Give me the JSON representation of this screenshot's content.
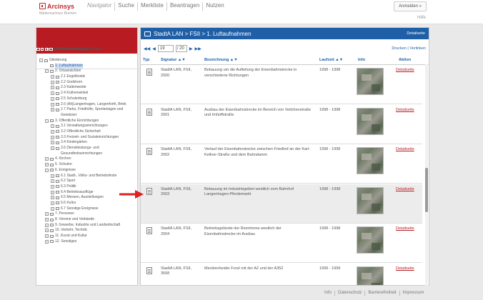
{
  "header": {
    "app_name": "Arcinsys",
    "app_sub": "Niedersachsen\nBremen",
    "nav": [
      "Navigator",
      "Suche",
      "Merkliste",
      "Beantragen",
      "Nutzen"
    ],
    "login": "Anmelden »",
    "help": "Hilfe"
  },
  "left": {
    "path": [
      "Archive in Niedersachsen und Bremen",
      "Stadtarchiv Langenhagen",
      "FSII Fotosammlung II"
    ],
    "tree": [
      {
        "label": "Gliederung",
        "level": 0,
        "kind": "folder",
        "toggle": "−"
      },
      {
        "label": "1. Luftaufnahmen",
        "level": 1,
        "kind": "file",
        "toggle": "",
        "selected": true
      },
      {
        "label": "2. Ortsansichten",
        "level": 1,
        "kind": "folder",
        "toggle": "−"
      },
      {
        "label": "2.1 Engelbostel",
        "level": 2,
        "kind": "file",
        "toggle": "+"
      },
      {
        "label": "2.2 Godshorn",
        "level": 2,
        "kind": "file",
        "toggle": "+"
      },
      {
        "label": "2.3 Kaltenweide",
        "level": 2,
        "kind": "file",
        "toggle": "+"
      },
      {
        "label": "2.4 Krähenwinkel",
        "level": 2,
        "kind": "file",
        "toggle": "+"
      },
      {
        "label": "2.5 Schulenburg",
        "level": 2,
        "kind": "file",
        "toggle": "+"
      },
      {
        "label": "2.6 (Alt)Langenhagen, Langenforth, Brink",
        "level": 2,
        "kind": "file",
        "toggle": "+"
      },
      {
        "label": "2.7 Parks, Friedhöfe, Sportanlagen und Gewässer",
        "level": 2,
        "kind": "file",
        "toggle": "+",
        "wrap": true
      },
      {
        "label": "3. Öffentliche Einrichtungen",
        "level": 1,
        "kind": "folder",
        "toggle": "−"
      },
      {
        "label": "3.1 Verwaltungseinrichtungen",
        "level": 2,
        "kind": "file",
        "toggle": "+"
      },
      {
        "label": "3.2 Öffentliche Sicherheit",
        "level": 2,
        "kind": "file",
        "toggle": "+"
      },
      {
        "label": "3.3 Freizeit- und Sozialeinrichtungen",
        "level": 2,
        "kind": "file",
        "toggle": "+"
      },
      {
        "label": "3.4 Kindergärten",
        "level": 2,
        "kind": "file",
        "toggle": "+"
      },
      {
        "label": "3.5 Dienstleistungs- und Gesundheitseinrichtungen",
        "level": 2,
        "kind": "file",
        "toggle": "+",
        "wrap": true
      },
      {
        "label": "4. Kirchen",
        "level": 1,
        "kind": "file",
        "toggle": "+"
      },
      {
        "label": "5. Schulen",
        "level": 1,
        "kind": "file",
        "toggle": "+"
      },
      {
        "label": "6. Ereignisse",
        "level": 1,
        "kind": "folder",
        "toggle": "−"
      },
      {
        "label": "6.1 Stadt-, Volks- und Betriebsfeste",
        "level": 2,
        "kind": "file",
        "toggle": "+"
      },
      {
        "label": "6.2 Sport",
        "level": 2,
        "kind": "file",
        "toggle": "+"
      },
      {
        "label": "6.3 Politik",
        "level": 2,
        "kind": "file",
        "toggle": "+"
      },
      {
        "label": "6.4 Betriebsausflüge",
        "level": 2,
        "kind": "file",
        "toggle": "+"
      },
      {
        "label": "6.5 Messen, Ausstellungen",
        "level": 2,
        "kind": "file",
        "toggle": "+"
      },
      {
        "label": "6.6 Kultur",
        "level": 2,
        "kind": "file",
        "toggle": "+"
      },
      {
        "label": "6.7 Sonstige Ereignisse",
        "level": 2,
        "kind": "file",
        "toggle": "+"
      },
      {
        "label": "7. Personen",
        "level": 1,
        "kind": "file",
        "toggle": "+"
      },
      {
        "label": "8. Vereine und Verbände",
        "level": 1,
        "kind": "file",
        "toggle": "+"
      },
      {
        "label": "9. Gewerbe, Industrie und Landwirtschaft",
        "level": 1,
        "kind": "file",
        "toggle": "+"
      },
      {
        "label": "10. Verkehr, Technik",
        "level": 1,
        "kind": "file",
        "toggle": "+"
      },
      {
        "label": "11. Kunst und Kultur",
        "level": 1,
        "kind": "file",
        "toggle": "+"
      },
      {
        "label": "12. Sonstiges",
        "level": 1,
        "kind": "file",
        "toggle": "+"
      }
    ]
  },
  "main": {
    "title": "StadtA LAN > FSII > 1. Luftaufnahmen",
    "details_link": "Detailseite",
    "pager": {
      "first": "◀◀",
      "prev": "◀",
      "current": "19",
      "total": "/ 20",
      "next": "▶",
      "last": "▶▶",
      "print": "Drucken",
      "link": "Verlinken"
    },
    "columns": [
      "Typ",
      "Signatur ▲▼",
      "Bezeichnung ▲▼",
      "Laufzeit ▲▼",
      "Info",
      "Aktion"
    ],
    "rows": [
      {
        "sig": "StadtA LAN, FSII, 2000",
        "bez": "Bebauung um die Aufteilung der Eisenbahnstrecke in verschiedene Richtungen",
        "lz": "1998 - 1998",
        "act": "Detailseite",
        "hl": false
      },
      {
        "sig": "StadtA LAN, FSII, 2001",
        "bez": "Ausbau der Eisenbahnstrecke im Bereich von Veilchenstraße und Imhoffstraße",
        "lz": "1998 - 1998",
        "act": "Detailseite",
        "hl": false
      },
      {
        "sig": "StadtA LAN, FSII, 2002",
        "bez": "Verlauf der Eisenbahnstrecke zwischen Friedhof an der Karl-Kellner-Straße und dem Bahndamm",
        "lz": "1998 - 1998",
        "act": "Detailseite",
        "hl": false
      },
      {
        "sig": "StadtA LAN, FSII, 2003",
        "bez": "Bebauung im Industriegebiet westlich vom Bahnhof Langenhagen-Pferdemarkt",
        "lz": "1998 - 1998",
        "act": "Detailseite",
        "hl": true
      },
      {
        "sig": "StadtA LAN, FSII, 2004",
        "bez": "Betriebsgelände der Reemtsma westlich der Eisenbahnstrecke im Ausbau",
        "lz": "1998 - 1998",
        "act": "Detailseite",
        "hl": false
      },
      {
        "sig": "StadtA LAN, FSII, 3558",
        "bez": "Mecklenheider Forst mit der A2 und der A352",
        "lz": "1999 - 1999",
        "act": "Detailseite",
        "hl": false
      }
    ]
  },
  "footer": [
    "Info",
    "Datenschutz",
    "Barrierefreiheit",
    "Impressum"
  ],
  "colors": {
    "brand_red": "#b81c22",
    "brand_blue": "#1f5fa8",
    "selected_row": "#ececec"
  }
}
